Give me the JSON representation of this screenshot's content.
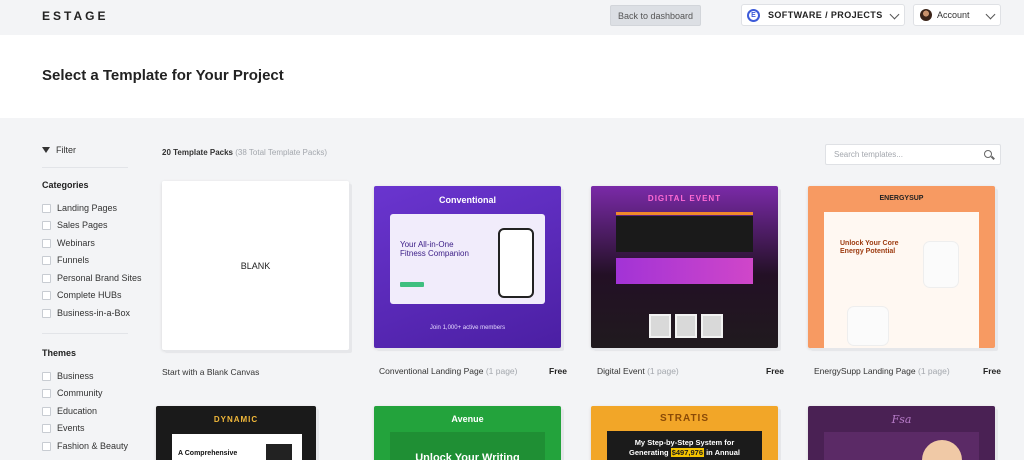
{
  "app": {
    "logo": "ESTAGE",
    "dashboard_button": "Back to dashboard",
    "project": "SOFTWARE / PROJECTS",
    "project_logo": "E",
    "account": "Account"
  },
  "page": {
    "title": "Select a Template for Your Project"
  },
  "sidebar": {
    "filter_label": "Filter",
    "categories_heading": "Categories",
    "categories": [
      "Landing Pages",
      "Sales Pages",
      "Webinars",
      "Funnels",
      "Personal Brand Sites",
      "Complete HUBs",
      "Business-in-a-Box"
    ],
    "themes_heading": "Themes",
    "themes": [
      "Business",
      "Community",
      "Education",
      "Events",
      "Fashion & Beauty"
    ]
  },
  "main": {
    "count_main": "20 Template Packs",
    "count_total": "(38 Total Template Packs)",
    "search_placeholder": "Search templates...",
    "blank": {
      "card_text": "BLANK",
      "label": "Start with a Blank Canvas"
    },
    "templates": [
      {
        "name": "Conventional Landing Page",
        "pages": "(1 page)",
        "price": "Free",
        "brand": "Conventional",
        "headline": "Your All-in-One Fitness Companion",
        "footer": "Join 1,000+ active members"
      },
      {
        "name": "Digital Event",
        "pages": "(1 page)",
        "price": "Free",
        "brand": "DIGITAL EVENT"
      },
      {
        "name": "EnergySupp Landing Page",
        "pages": "(1 page)",
        "price": "Free",
        "brand": "ENERGYSUP",
        "headline": "Unlock Your Core Energy Potential"
      }
    ],
    "row2": {
      "dynamic_brand": "DYNAMIC",
      "dynamic_headline": "A Comprehensive",
      "avenue_brand": "Avenue",
      "avenue_headline": "Unlock Your Writing",
      "stratis_brand": "STRATIS",
      "stratis_line1": "My Step-by-Step System for",
      "stratis_line2a": "Generating",
      "stratis_line2b": "$497,976",
      "stratis_line2c": "in Annual",
      "fashion_brand": "Fsa"
    }
  },
  "colors": {
    "accent": "#3d5bd9",
    "page_bg": "#f3f4f6"
  }
}
